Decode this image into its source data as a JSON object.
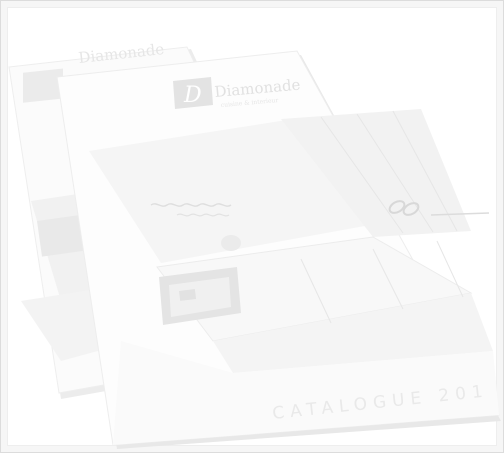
{
  "back_catalogue": {
    "brand_name": "Diamonade"
  },
  "front_catalogue": {
    "brand_name": "Diamonade",
    "brand_tagline": "cuisine & interieur",
    "cover_title": "CATALOGUE 201"
  },
  "colors": {
    "page_background": "#f6f6f6",
    "catalogue_paper": "#ffffff",
    "logo_box": "#e3e3e3",
    "cover_text": "#ececec"
  }
}
